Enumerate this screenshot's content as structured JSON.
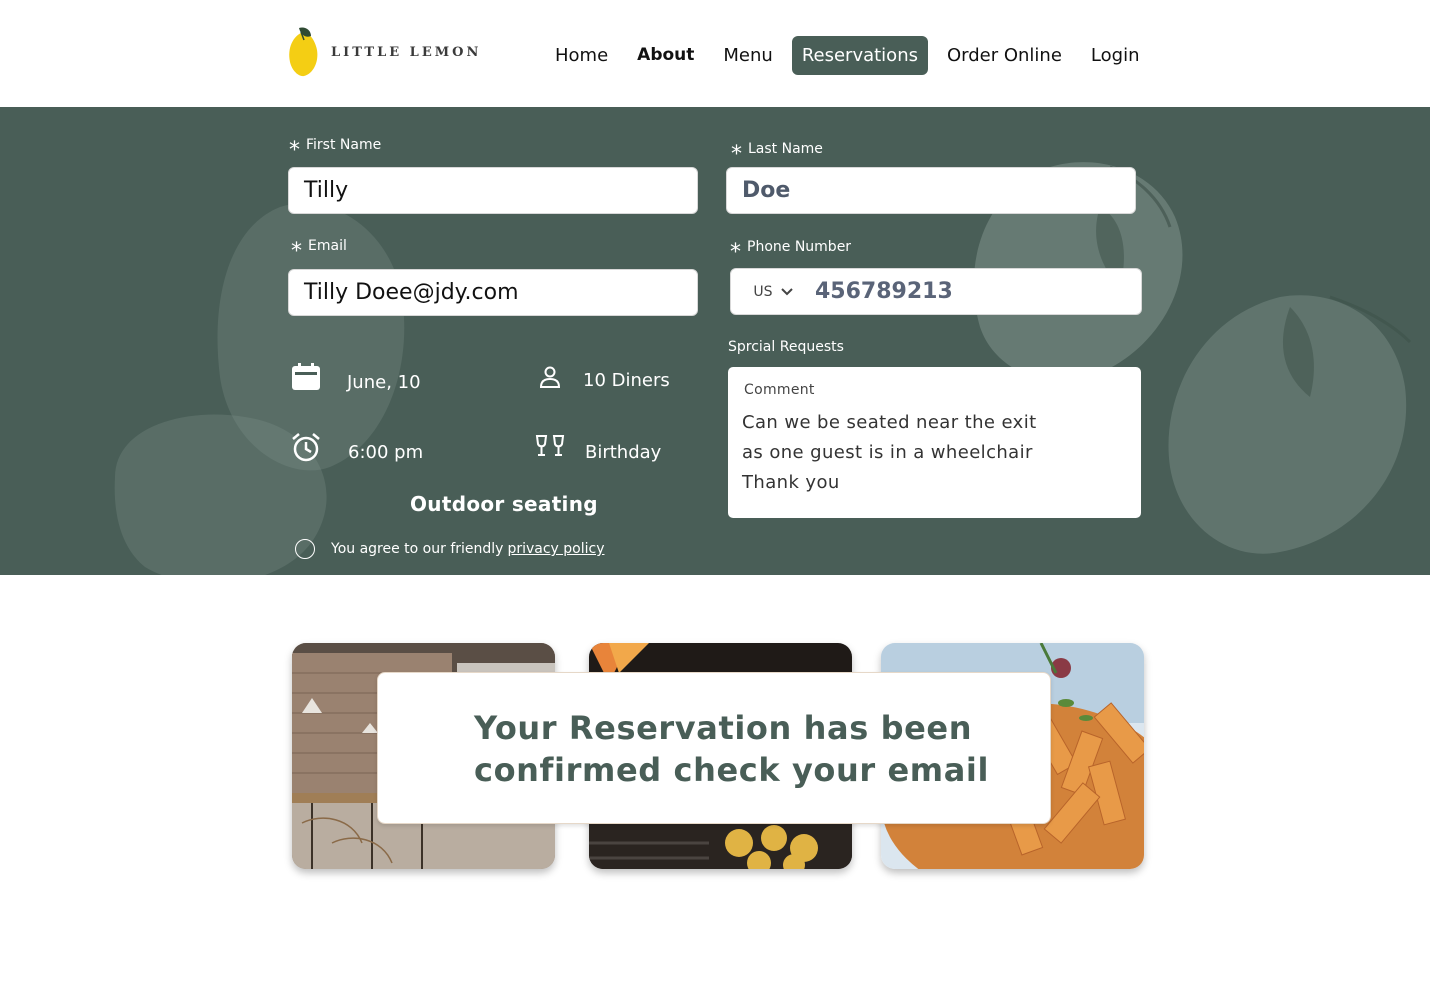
{
  "brand": {
    "name": "LITTLE LEMON",
    "accent": "#495e57",
    "lemon": "#f4ce14"
  },
  "nav": {
    "items": [
      "Home",
      "About",
      "Menu",
      "Reservations",
      "Order Online",
      "Login"
    ],
    "active": "Reservations"
  },
  "form": {
    "first_name": {
      "label": "First Name",
      "value": "Tilly"
    },
    "last_name": {
      "label": "Last Name",
      "value": "Doe"
    },
    "email": {
      "label": "Email",
      "value": "Tilly Doee@jdy.com"
    },
    "phone": {
      "label": "Phone Number",
      "country": "US",
      "value": "456789213"
    },
    "date": "June, 10",
    "diners": "10 Diners",
    "time": "6:00 pm",
    "occasion": "Birthday",
    "seating": "Outdoor seating",
    "agree_text": "You agree to our friendly",
    "privacy_link": "privacy policy",
    "special": {
      "label": "Sprcial Requests",
      "comment_label": "Comment",
      "comment": "Can we be seated near the exit\nas one guest is in a wheelchair\nThank you"
    },
    "required_marker": "*"
  },
  "confirmation": {
    "message": "Your  Reservation has been confirmed check your email"
  },
  "photos": [
    "restaurant-interior",
    "grill-food",
    "pasta-dish"
  ]
}
